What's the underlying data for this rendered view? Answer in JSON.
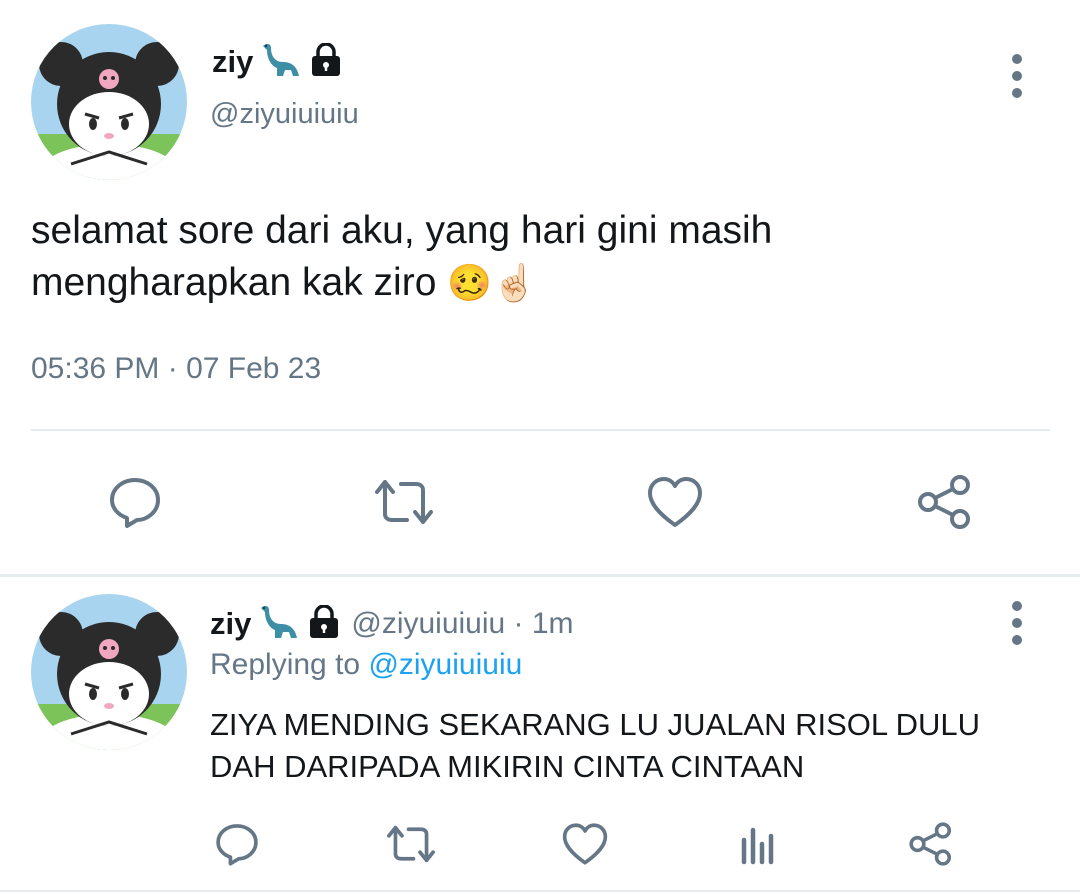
{
  "main_tweet": {
    "display_name": "ziy",
    "handle": "@ziyuiuiuiu",
    "text_line1": "selamat sore dari aku, yang hari gini masih",
    "text_line2": "mengharapkan kak ziro",
    "emoji": "🥴☝🏻",
    "timestamp": "05:36 PM · 07 Feb 23"
  },
  "reply_tweet": {
    "display_name": "ziy",
    "handle_time": "@ziyuiuiuiu · 1m",
    "replying_prefix": "Replying to ",
    "replying_handle": "@ziyuiuiuiu",
    "text_line1": "ZIYA MENDING SEKARANG LU JUALAN RISOL DULU",
    "text_line2": "DAH DARIPADA MIKIRIN CINTA CINTAAN"
  },
  "icons": {
    "dino": "sauropod-icon",
    "lock": "lock-icon",
    "reply": "comment-icon",
    "retweet": "retweet-icon",
    "like": "heart-icon",
    "share": "share-icon",
    "analytics": "analytics-icon",
    "menu": "more-vertical-icon"
  },
  "colors": {
    "text": "#14171a",
    "secondary": "#657786",
    "link": "#1da1f2",
    "divider": "#e6ecf0"
  }
}
